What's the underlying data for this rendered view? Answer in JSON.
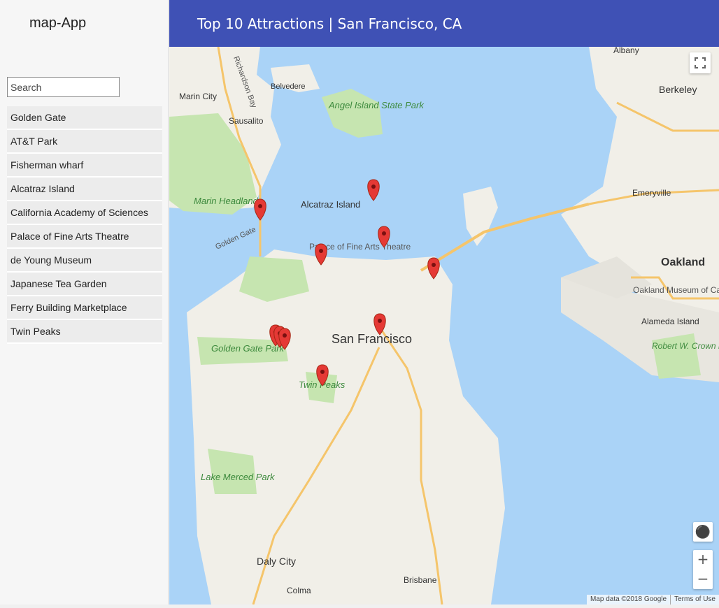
{
  "app": {
    "title": "map-App"
  },
  "header": {
    "title": "Top 10 Attractions | San Francisco, CA"
  },
  "search": {
    "placeholder": "Search"
  },
  "places": [
    "Golden Gate",
    "AT&T Park",
    "Fisherman wharf",
    "Alcatraz Island",
    "California Academy of Sciences",
    "Palace of Fine Arts Theatre",
    "de Young Museum",
    "Japanese Tea Garden",
    "Ferry Building Marketplace",
    "Twin Peaks"
  ],
  "map": {
    "labels": {
      "san_francisco": "San Francisco",
      "oakland": "Oakland",
      "berkeley": "Berkeley",
      "emeryville": "Emeryville",
      "alameda": "Alameda Island",
      "albany": "Albany",
      "sausalito": "Sausalito",
      "marin_city": "Marin City",
      "belvedere": "Belvedere",
      "daly_city": "Daly City",
      "brisbane": "Brisbane",
      "colma": "Colma",
      "angel_island": "Angel Island State Park",
      "alcatraz": "Alcatraz Island",
      "marin_headlands": "Marin Headlands",
      "golden_gate_park": "Golden Gate Park",
      "twin_peaks": "Twin Peaks",
      "lake_merced": "Lake Merced Park",
      "palace": "Palace of Fine Arts Theatre",
      "oakland_museum": "Oakland Museum of California",
      "robert_crown": "Robert W. Crown Memorial State Beach",
      "golden_gate": "Golden Gate",
      "richardson_bay": "Richardson Bay"
    },
    "footer_data": "Map data ©2018 Google",
    "footer_terms": "Terms of Use"
  },
  "colors": {
    "header": "#3f51b5",
    "water": "#aad3f7",
    "land": "#f1efe8",
    "park": "#c6e5b0",
    "marker": "#e53935"
  }
}
